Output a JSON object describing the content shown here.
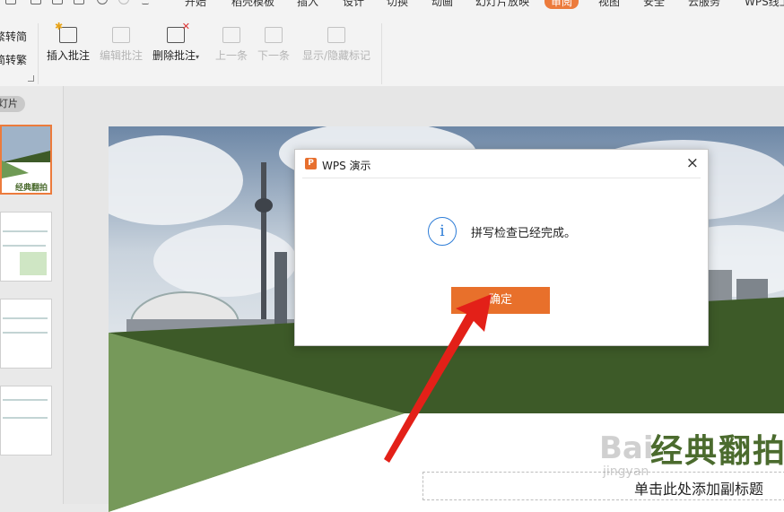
{
  "ribbon": {
    "tabs": [
      "开始",
      "稻壳模板",
      "插入",
      "设计",
      "切换",
      "动画",
      "幻灯片放映",
      "审阅",
      "视图",
      "安全",
      "云服务",
      "WPS线上"
    ],
    "active_tab": "审阅"
  },
  "toolbar": {
    "small_buttons": [
      "繁转简",
      "简转繁"
    ],
    "buttons": [
      {
        "label": "插入批注",
        "enabled": true,
        "icon": "insert-comment-icon"
      },
      {
        "label": "编辑批注",
        "enabled": false,
        "icon": "edit-comment-icon"
      },
      {
        "label": "删除批注",
        "enabled": true,
        "icon": "delete-comment-icon",
        "has_dropdown": true
      },
      {
        "label": "上一条",
        "enabled": false,
        "icon": "previous-comment-icon"
      },
      {
        "label": "下一条",
        "enabled": false,
        "icon": "next-comment-icon"
      },
      {
        "label": "显示/隐藏标记",
        "enabled": false,
        "icon": "show-hide-markup-icon"
      }
    ]
  },
  "left_panel": {
    "tab_label": "灯片",
    "thumbnails": [
      {
        "selected": true,
        "caption": "经典翻拍"
      },
      {
        "selected": false
      },
      {
        "selected": false
      },
      {
        "selected": false
      }
    ]
  },
  "slide": {
    "title": "经典翻拍",
    "subtitle_placeholder": "单击此处添加副标题",
    "colors": {
      "green_dark": "#3d5a28",
      "green_light": "#6f9a55",
      "title_green": "#4b6b2e"
    }
  },
  "dialog": {
    "title": "WPS 演示",
    "logo": "P",
    "close": "×",
    "info_symbol": "i",
    "message": "拼写检查已经完成。",
    "ok_label": "确定",
    "accent": "#e8702b"
  },
  "watermark": {
    "text": "Bai",
    "sub": "jingyan"
  }
}
